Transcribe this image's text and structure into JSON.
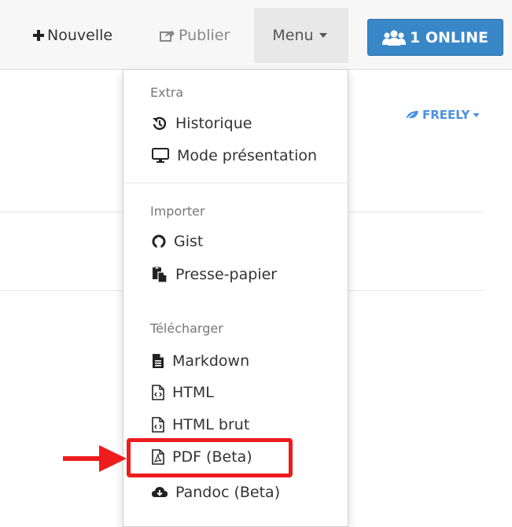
{
  "navbar": {
    "new_label": "Nouvelle",
    "publish_label": "Publier",
    "menu_label": "Menu",
    "online_label": "1 ONLINE"
  },
  "permission": {
    "label": "FREELY"
  },
  "menu": {
    "sections": [
      {
        "header": "Extra",
        "items": [
          {
            "label": "Historique",
            "icon": "history-icon"
          },
          {
            "label": "Mode présentation",
            "icon": "monitor-icon"
          }
        ]
      },
      {
        "header": "Importer",
        "items": [
          {
            "label": "Gist",
            "icon": "github-icon"
          },
          {
            "label": "Presse-papier",
            "icon": "clipboard-icon"
          }
        ]
      },
      {
        "header": "Télécharger",
        "items": [
          {
            "label": "Markdown",
            "icon": "file-icon"
          },
          {
            "label": "HTML",
            "icon": "file-code-icon"
          },
          {
            "label": "HTML brut",
            "icon": "file-code-icon"
          },
          {
            "label": "PDF (Beta)",
            "icon": "file-pdf-icon"
          },
          {
            "label": "Pandoc (Beta)",
            "icon": "cloud-download-icon"
          }
        ]
      }
    ]
  },
  "annotation": {
    "highlight_color": "#ee1c1c",
    "target": "PDF (Beta)"
  },
  "colors": {
    "online_button": "#3a87c8",
    "freely": "#4a90e2",
    "navbar": "#f7f7f7"
  }
}
